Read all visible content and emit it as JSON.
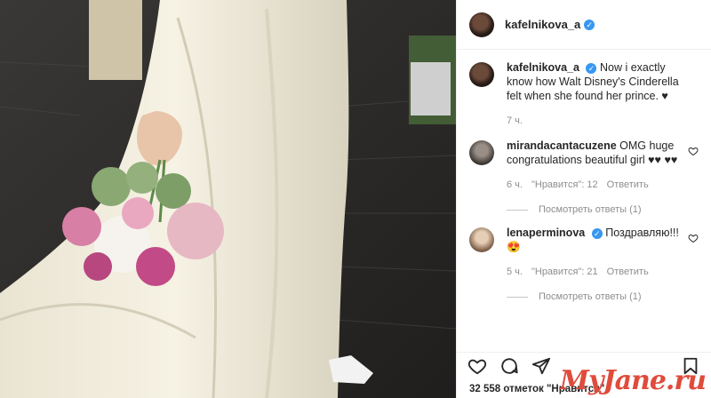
{
  "post": {
    "username": "kafelnikova_a",
    "verified_mark": "✓",
    "caption": "Now i exactly know how Walt Disney's Cinderella felt when she found her prince. ♥",
    "time": "7 ч."
  },
  "comments": [
    {
      "username": "mirandacantacuzene",
      "text": "OMG huge congratulations beautiful girl ♥♥ ♥♥",
      "time": "6 ч.",
      "likes": "\"Нравится\": 12",
      "reply": "Ответить",
      "view_replies": "Посмотреть ответы (1)"
    },
    {
      "username": "lenaperminova",
      "text": "Поздравляю!!! 😍",
      "time": "5 ч.",
      "likes": "\"Нравится\": 21",
      "reply": "Ответить",
      "view_replies": "Посмотреть ответы (1)"
    }
  ],
  "likes_text": "32 558 отметок \"Нравится\"",
  "watermark": "MyJane.ru",
  "icons": [
    "heart-icon",
    "comment-icon",
    "share-icon",
    "bookmark-icon",
    "verified-icon"
  ],
  "colors": {
    "verified": "#3897f0",
    "watermark": "#e04b3b"
  }
}
